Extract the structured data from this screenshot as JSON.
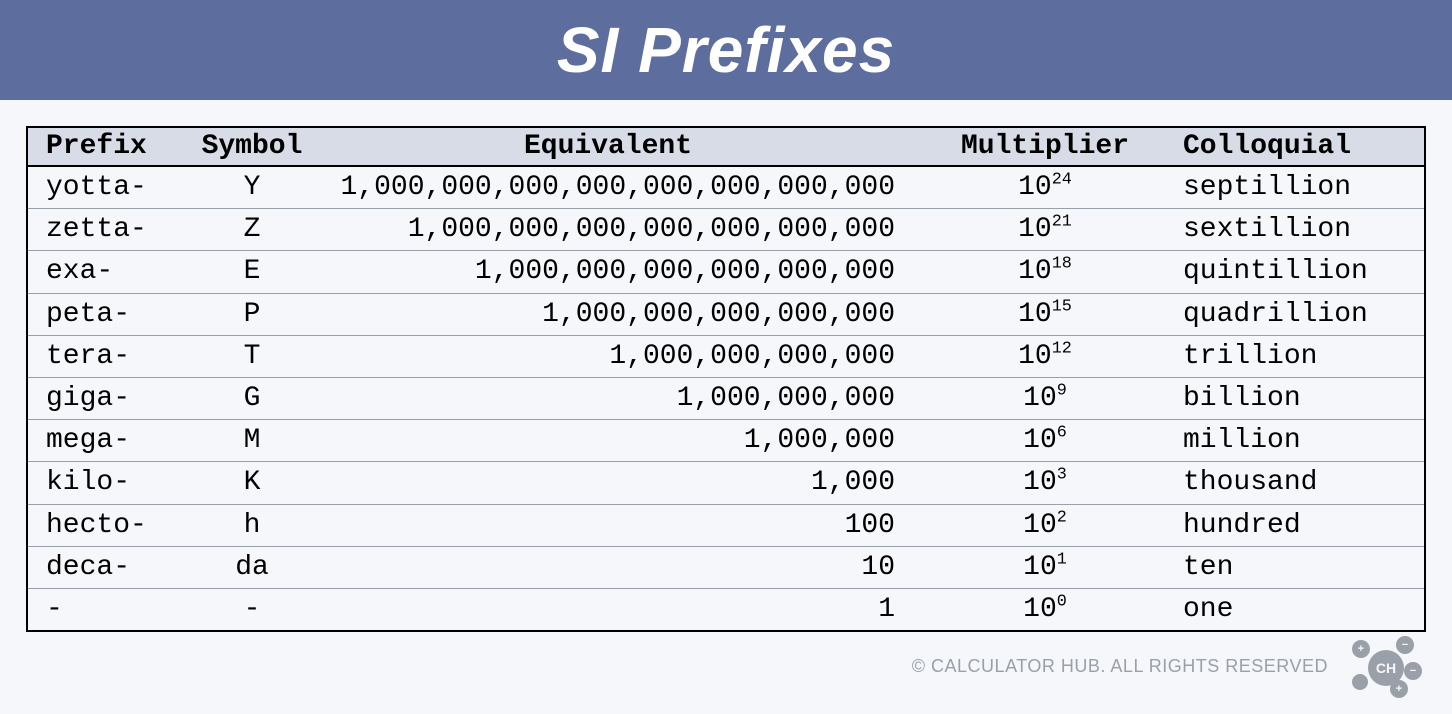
{
  "title": "SI Prefixes",
  "columns": {
    "prefix": "Prefix",
    "symbol": "Symbol",
    "equivalent": "Equivalent",
    "multiplier": "Multiplier",
    "colloquial": "Colloquial"
  },
  "rows": [
    {
      "prefix": "yotta-",
      "symbol": "Y",
      "equivalent": "1,000,000,000,000,000,000,000,000",
      "mult_base": "10",
      "mult_exp": "24",
      "colloquial": "septillion"
    },
    {
      "prefix": "zetta-",
      "symbol": "Z",
      "equivalent": "1,000,000,000,000,000,000,000",
      "mult_base": "10",
      "mult_exp": "21",
      "colloquial": "sextillion"
    },
    {
      "prefix": "exa-",
      "symbol": "E",
      "equivalent": "1,000,000,000,000,000,000",
      "mult_base": "10",
      "mult_exp": "18",
      "colloquial": "quintillion"
    },
    {
      "prefix": "peta-",
      "symbol": "P",
      "equivalent": "1,000,000,000,000,000",
      "mult_base": "10",
      "mult_exp": "15",
      "colloquial": "quadrillion"
    },
    {
      "prefix": "tera-",
      "symbol": "T",
      "equivalent": "1,000,000,000,000",
      "mult_base": "10",
      "mult_exp": "12",
      "colloquial": "trillion"
    },
    {
      "prefix": "giga-",
      "symbol": "G",
      "equivalent": "1,000,000,000",
      "mult_base": "10",
      "mult_exp": "9",
      "colloquial": "billion"
    },
    {
      "prefix": "mega-",
      "symbol": "M",
      "equivalent": "1,000,000",
      "mult_base": "10",
      "mult_exp": "6",
      "colloquial": "million"
    },
    {
      "prefix": "kilo-",
      "symbol": "K",
      "equivalent": "1,000",
      "mult_base": "10",
      "mult_exp": "3",
      "colloquial": "thousand"
    },
    {
      "prefix": "hecto-",
      "symbol": "h",
      "equivalent": "100",
      "mult_base": "10",
      "mult_exp": "2",
      "colloquial": "hundred"
    },
    {
      "prefix": "deca-",
      "symbol": "da",
      "equivalent": "10",
      "mult_base": "10",
      "mult_exp": "1",
      "colloquial": "ten"
    },
    {
      "prefix": "-",
      "symbol": "-",
      "equivalent": "1",
      "mult_base": "10",
      "mult_exp": "0",
      "colloquial": "one"
    }
  ],
  "footer_text": "© CALCULATOR HUB. ALL RIGHTS RESERVED",
  "logo_label": "CH"
}
